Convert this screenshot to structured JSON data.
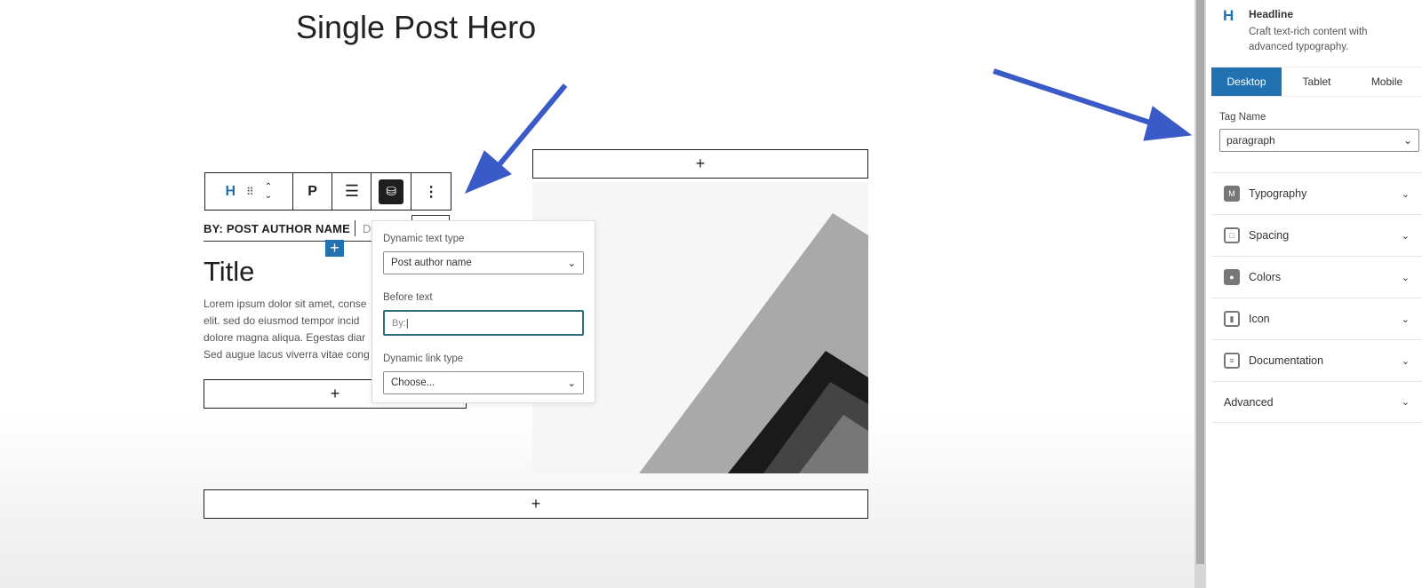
{
  "page_title": "Single Post Hero",
  "toolbar": {
    "block_icon": "H",
    "paragraph": "P",
    "more": "⋮"
  },
  "block": {
    "byline": "BY: POST AUTHOR NAME",
    "next_text": "D",
    "title": "Title",
    "lorem": [
      "Lorem ipsum dolor sit amet, conse",
      "elit. sed do eiusmod tempor incid",
      "dolore magna aliqua. Egestas diar",
      "Sed augue lacus viverra vitae cong"
    ],
    "plus": "+"
  },
  "popover": {
    "dynamic_text_type_label": "Dynamic text type",
    "dynamic_text_type_value": "Post author name",
    "before_text_label": "Before text",
    "before_text_value": "By:",
    "dynamic_link_type_label": "Dynamic link type",
    "dynamic_link_type_value": "Choose..."
  },
  "sidebar": {
    "block_icon": "H",
    "block_name": "Headline",
    "block_desc": "Craft text-rich content with advanced typography.",
    "tabs": [
      "Desktop",
      "Tablet",
      "Mobile"
    ],
    "active_tab": "Desktop",
    "tag_name_label": "Tag Name",
    "tag_name_value": "paragraph",
    "panels": [
      {
        "label": "Typography",
        "icon": "typography-icon"
      },
      {
        "label": "Spacing",
        "icon": "spacing-icon"
      },
      {
        "label": "Colors",
        "icon": "palette-icon"
      },
      {
        "label": "Icon",
        "icon": "icon-icon"
      },
      {
        "label": "Documentation",
        "icon": "documentation-icon"
      },
      {
        "label": "Advanced"
      }
    ]
  },
  "colors": {
    "accent": "#2271b1",
    "arrow": "#3a5bc7"
  }
}
